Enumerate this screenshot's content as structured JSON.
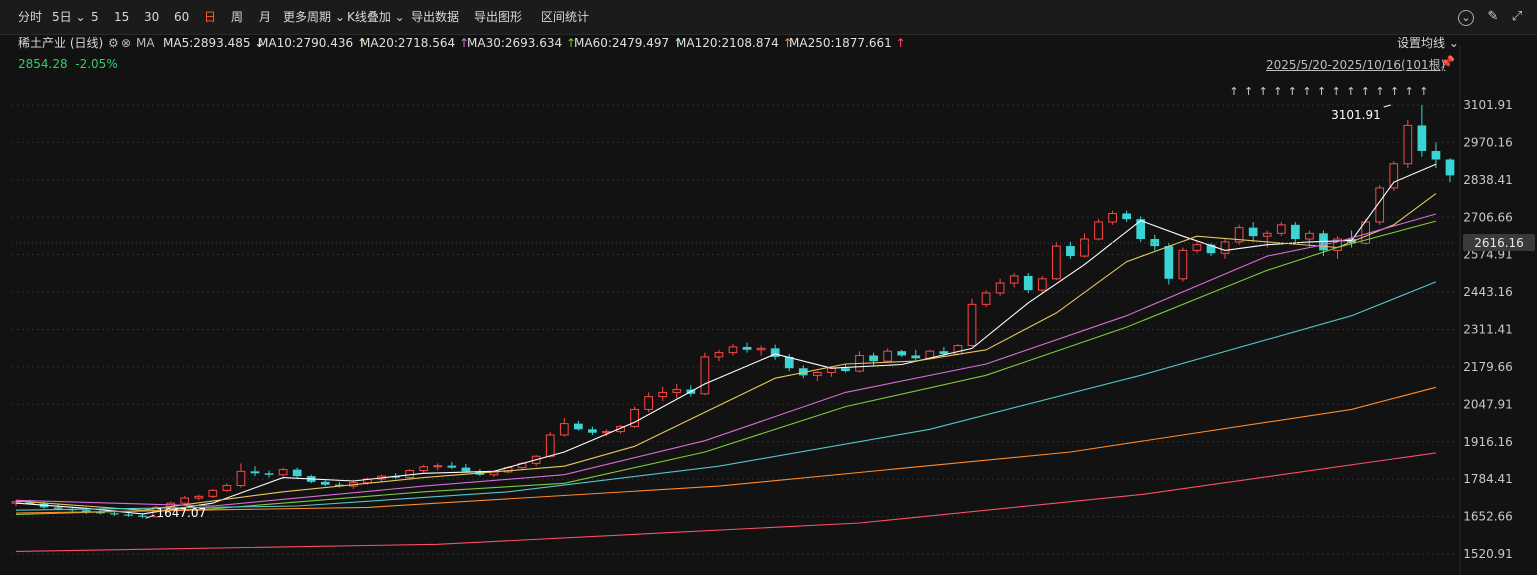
{
  "toolbar": {
    "items": [
      {
        "label": "分时",
        "active": false
      },
      {
        "label": "5日",
        "active": false,
        "dropdown": true
      },
      {
        "label": "5",
        "active": false
      },
      {
        "label": "15",
        "active": false
      },
      {
        "label": "30",
        "active": false
      },
      {
        "label": "60",
        "active": false
      },
      {
        "label": "日",
        "active": true
      },
      {
        "label": "周",
        "active": false
      },
      {
        "label": "月",
        "active": false
      },
      {
        "label": "更多周期",
        "active": false,
        "dropdown": true
      },
      {
        "label": "K线叠加",
        "active": false,
        "dropdown": true
      },
      {
        "label": "导出数据",
        "active": false
      },
      {
        "label": "导出图形",
        "active": false
      },
      {
        "label": "区间统计",
        "active": false
      }
    ],
    "icons": [
      "chevron-circle-icon",
      "brush-icon",
      "expand-icon"
    ]
  },
  "legend": {
    "instrument": "稀土产业 (日线)",
    "ma_label": "MA",
    "settings_icon": "gear-icon",
    "close_icon": "close-icon",
    "ma_items": [
      {
        "label": "MA5:2893.485",
        "arrow": "↓",
        "color": "#ffffff"
      },
      {
        "label": "MA10:2790.436",
        "arrow": "↑",
        "color": "#e8c65a"
      },
      {
        "label": "MA20:2718.564",
        "arrow": "↑",
        "color": "#d86cd8"
      },
      {
        "label": "MA30:2693.634",
        "arrow": "↑",
        "color": "#7ecb3c"
      },
      {
        "label": "MA60:2479.497",
        "arrow": "↑",
        "color": "#56c5c8"
      },
      {
        "label": "MA120:2108.874",
        "arrow": "↑",
        "color": "#ff8a2a"
      },
      {
        "label": "MA250:1877.661",
        "arrow": "↑",
        "color": "#ff4d6a"
      }
    ],
    "set_ma_label": "设置均线",
    "price_value": "2854.28",
    "price_change": "-2.05%",
    "range_label": "2025/5/20-2025/10/16(101根)"
  },
  "colors": {
    "up": "#ff4646",
    "down": "#3ad4d4",
    "grid": "#2c2c2c",
    "axis_text": "#c8c8c8"
  },
  "chart_data": {
    "type": "candlestick",
    "y_ticks": [
      3101.91,
      2970.16,
      2838.41,
      2706.66,
      2574.91,
      2443.16,
      2311.41,
      2179.66,
      2047.91,
      1916.16,
      1784.41,
      1652.66,
      1520.91
    ],
    "y_tick_labels": [
      "3101.91",
      "2970.16",
      "2838.41",
      "2706.66",
      "2574.91",
      "2443.16",
      "2311.41",
      "2179.66",
      "2047.91",
      "1916.16",
      "1784.41",
      "1652.66",
      "1520.91"
    ],
    "ylim": [
      1500,
      3170
    ],
    "current_price": 2616.16,
    "current_price_label": "2616.16",
    "high_annotation": {
      "index": 98,
      "value": 3101.91,
      "label": "3101.91"
    },
    "low_annotation": {
      "index": 9,
      "value": 1647.07,
      "label": "1647.07"
    },
    "ohlc": [
      [
        1700,
        1710,
        1690,
        1705
      ],
      [
        1703,
        1712,
        1695,
        1698
      ],
      [
        1698,
        1705,
        1680,
        1685
      ],
      [
        1685,
        1695,
        1675,
        1680
      ],
      [
        1680,
        1688,
        1670,
        1675
      ],
      [
        1675,
        1682,
        1662,
        1668
      ],
      [
        1668,
        1676,
        1660,
        1664
      ],
      [
        1664,
        1672,
        1655,
        1660
      ],
      [
        1660,
        1668,
        1652,
        1656
      ],
      [
        1656,
        1662,
        1647,
        1652
      ],
      [
        1652,
        1690,
        1650,
        1685
      ],
      [
        1685,
        1705,
        1680,
        1700
      ],
      [
        1700,
        1725,
        1695,
        1718
      ],
      [
        1718,
        1730,
        1710,
        1724
      ],
      [
        1724,
        1750,
        1718,
        1745
      ],
      [
        1745,
        1770,
        1740,
        1762
      ],
      [
        1762,
        1840,
        1755,
        1812
      ],
      [
        1812,
        1830,
        1795,
        1805
      ],
      [
        1805,
        1815,
        1790,
        1800
      ],
      [
        1800,
        1825,
        1795,
        1818
      ],
      [
        1818,
        1825,
        1790,
        1795
      ],
      [
        1795,
        1800,
        1770,
        1775
      ],
      [
        1775,
        1780,
        1760,
        1765
      ],
      [
        1765,
        1775,
        1755,
        1760
      ],
      [
        1760,
        1780,
        1750,
        1772
      ],
      [
        1772,
        1790,
        1765,
        1785
      ],
      [
        1785,
        1800,
        1775,
        1795
      ],
      [
        1795,
        1805,
        1785,
        1790
      ],
      [
        1790,
        1820,
        1785,
        1815
      ],
      [
        1815,
        1835,
        1808,
        1828
      ],
      [
        1828,
        1840,
        1815,
        1832
      ],
      [
        1832,
        1845,
        1820,
        1825
      ],
      [
        1825,
        1838,
        1810,
        1812
      ],
      [
        1812,
        1820,
        1795,
        1800
      ],
      [
        1800,
        1815,
        1792,
        1810
      ],
      [
        1810,
        1830,
        1805,
        1825
      ],
      [
        1825,
        1845,
        1818,
        1840
      ],
      [
        1840,
        1870,
        1830,
        1865
      ],
      [
        1865,
        1950,
        1860,
        1940
      ],
      [
        1940,
        2000,
        1935,
        1980
      ],
      [
        1980,
        1990,
        1955,
        1960
      ],
      [
        1960,
        1970,
        1940,
        1948
      ],
      [
        1948,
        1960,
        1935,
        1952
      ],
      [
        1952,
        1975,
        1945,
        1970
      ],
      [
        1970,
        2040,
        1965,
        2030
      ],
      [
        2030,
        2090,
        2020,
        2075
      ],
      [
        2075,
        2110,
        2060,
        2090
      ],
      [
        2090,
        2120,
        2070,
        2100
      ],
      [
        2100,
        2115,
        2075,
        2085
      ],
      [
        2085,
        2230,
        2080,
        2215
      ],
      [
        2215,
        2240,
        2200,
        2230
      ],
      [
        2230,
        2260,
        2220,
        2250
      ],
      [
        2250,
        2265,
        2230,
        2240
      ],
      [
        2240,
        2255,
        2220,
        2245
      ],
      [
        2245,
        2258,
        2205,
        2215
      ],
      [
        2215,
        2225,
        2165,
        2175
      ],
      [
        2175,
        2185,
        2140,
        2150
      ],
      [
        2150,
        2165,
        2130,
        2160
      ],
      [
        2160,
        2180,
        2145,
        2175
      ],
      [
        2175,
        2190,
        2160,
        2165
      ],
      [
        2165,
        2235,
        2160,
        2220
      ],
      [
        2220,
        2230,
        2185,
        2200
      ],
      [
        2200,
        2245,
        2195,
        2235
      ],
      [
        2235,
        2240,
        2215,
        2220
      ],
      [
        2220,
        2240,
        2200,
        2210
      ],
      [
        2210,
        2240,
        2205,
        2235
      ],
      [
        2235,
        2250,
        2215,
        2225
      ],
      [
        2225,
        2260,
        2220,
        2255
      ],
      [
        2255,
        2420,
        2250,
        2400
      ],
      [
        2400,
        2450,
        2390,
        2440
      ],
      [
        2440,
        2490,
        2430,
        2475
      ],
      [
        2475,
        2510,
        2460,
        2500
      ],
      [
        2500,
        2510,
        2440,
        2450
      ],
      [
        2450,
        2500,
        2440,
        2490
      ],
      [
        2490,
        2620,
        2485,
        2605
      ],
      [
        2605,
        2620,
        2560,
        2570
      ],
      [
        2570,
        2650,
        2565,
        2630
      ],
      [
        2630,
        2700,
        2625,
        2690
      ],
      [
        2690,
        2730,
        2680,
        2720
      ],
      [
        2720,
        2730,
        2690,
        2700
      ],
      [
        2700,
        2710,
        2620,
        2630
      ],
      [
        2630,
        2645,
        2590,
        2605
      ],
      [
        2605,
        2615,
        2470,
        2490
      ],
      [
        2490,
        2600,
        2480,
        2590
      ],
      [
        2590,
        2620,
        2580,
        2610
      ],
      [
        2610,
        2615,
        2570,
        2580
      ],
      [
        2580,
        2630,
        2560,
        2620
      ],
      [
        2620,
        2680,
        2610,
        2670
      ],
      [
        2670,
        2690,
        2620,
        2640
      ],
      [
        2640,
        2660,
        2600,
        2650
      ],
      [
        2650,
        2690,
        2640,
        2680
      ],
      [
        2680,
        2690,
        2620,
        2630
      ],
      [
        2630,
        2660,
        2600,
        2650
      ],
      [
        2650,
        2660,
        2570,
        2590
      ],
      [
        2590,
        2640,
        2560,
        2630
      ],
      [
        2630,
        2660,
        2600,
        2615
      ],
      [
        2615,
        2700,
        2610,
        2690
      ],
      [
        2690,
        2820,
        2680,
        2810
      ],
      [
        2810,
        2905,
        2800,
        2895
      ],
      [
        2895,
        3050,
        2880,
        3030
      ],
      [
        3030,
        3102,
        2920,
        2940
      ],
      [
        2940,
        2970,
        2880,
        2910
      ],
      [
        2910,
        2915,
        2830,
        2854
      ]
    ],
    "ma_series": [
      {
        "name": "MA5",
        "color": "#ffffff",
        "points": [
          [
            0,
            1700
          ],
          [
            5,
            1682
          ],
          [
            9,
            1662
          ],
          [
            14,
            1700
          ],
          [
            19,
            1790
          ],
          [
            24,
            1778
          ],
          [
            29,
            1805
          ],
          [
            34,
            1812
          ],
          [
            39,
            1880
          ],
          [
            44,
            1985
          ],
          [
            49,
            2120
          ],
          [
            54,
            2225
          ],
          [
            58,
            2175
          ],
          [
            63,
            2188
          ],
          [
            68,
            2245
          ],
          [
            72,
            2405
          ],
          [
            76,
            2540
          ],
          [
            80,
            2695
          ],
          [
            83,
            2640
          ],
          [
            86,
            2590
          ],
          [
            89,
            2610
          ],
          [
            92,
            2620
          ],
          [
            95,
            2625
          ],
          [
            98,
            2830
          ],
          [
            101,
            2893
          ]
        ]
      },
      {
        "name": "MA10",
        "color": "#e8c65a",
        "points": [
          [
            0,
            1708
          ],
          [
            9,
            1675
          ],
          [
            19,
            1740
          ],
          [
            29,
            1790
          ],
          [
            39,
            1830
          ],
          [
            44,
            1900
          ],
          [
            49,
            2020
          ],
          [
            54,
            2140
          ],
          [
            59,
            2190
          ],
          [
            64,
            2200
          ],
          [
            69,
            2240
          ],
          [
            74,
            2370
          ],
          [
            79,
            2550
          ],
          [
            84,
            2640
          ],
          [
            89,
            2620
          ],
          [
            94,
            2600
          ],
          [
            98,
            2680
          ],
          [
            101,
            2790
          ]
        ]
      },
      {
        "name": "MA20",
        "color": "#d86cd8",
        "points": [
          [
            0,
            1710
          ],
          [
            14,
            1690
          ],
          [
            29,
            1760
          ],
          [
            39,
            1800
          ],
          [
            49,
            1920
          ],
          [
            59,
            2090
          ],
          [
            69,
            2190
          ],
          [
            79,
            2360
          ],
          [
            89,
            2570
          ],
          [
            94,
            2620
          ],
          [
            101,
            2718
          ]
        ]
      },
      {
        "name": "MA30",
        "color": "#7ecb3c",
        "points": [
          [
            0,
            1660
          ],
          [
            14,
            1680
          ],
          [
            29,
            1740
          ],
          [
            39,
            1770
          ],
          [
            49,
            1880
          ],
          [
            59,
            2040
          ],
          [
            69,
            2150
          ],
          [
            79,
            2320
          ],
          [
            89,
            2520
          ],
          [
            94,
            2600
          ],
          [
            101,
            2693
          ]
        ]
      },
      {
        "name": "MA60",
        "color": "#56c5c8",
        "points": [
          [
            0,
            1675
          ],
          [
            20,
            1690
          ],
          [
            35,
            1740
          ],
          [
            50,
            1830
          ],
          [
            65,
            1960
          ],
          [
            80,
            2150
          ],
          [
            95,
            2360
          ],
          [
            101,
            2479
          ]
        ]
      },
      {
        "name": "MA120",
        "color": "#ff8a2a",
        "points": [
          [
            0,
            1665
          ],
          [
            25,
            1685
          ],
          [
            50,
            1760
          ],
          [
            75,
            1880
          ],
          [
            95,
            2030
          ],
          [
            101,
            2108
          ]
        ]
      },
      {
        "name": "MA250",
        "color": "#ff4d6a",
        "points": [
          [
            0,
            1530
          ],
          [
            30,
            1555
          ],
          [
            60,
            1630
          ],
          [
            80,
            1730
          ],
          [
            101,
            1877
          ]
        ]
      }
    ],
    "signal_arrows": {
      "count": 14,
      "symbol": "↑"
    }
  }
}
